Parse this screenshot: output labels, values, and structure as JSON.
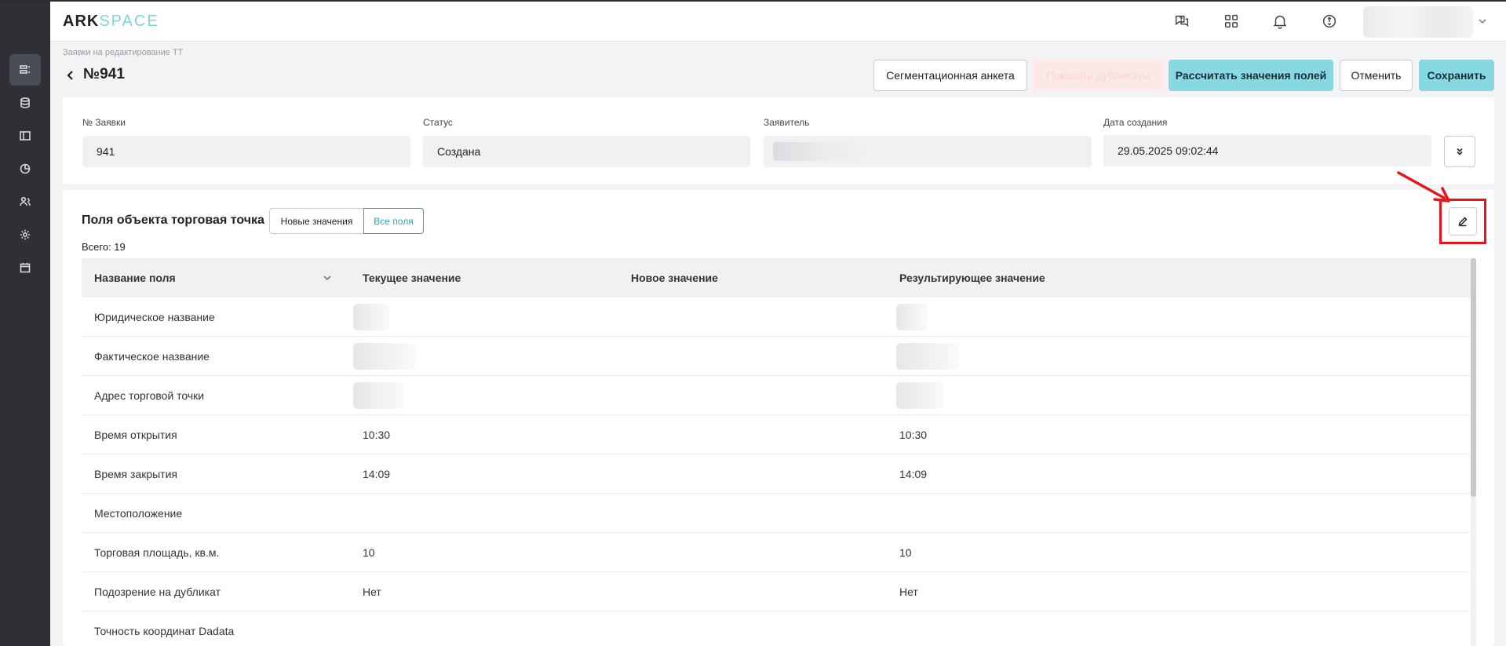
{
  "header": {
    "logo_main": "ARK",
    "logo_accent": "SPACE",
    "icons": [
      "support-chat-icon",
      "apps-grid-icon",
      "bell-icon",
      "sync-icon"
    ]
  },
  "sidebar": {
    "items": [
      "requests-icon",
      "database-icon",
      "layout-icon",
      "analytics-icon",
      "users-icon",
      "settings-icon",
      "calendar-icon"
    ],
    "active_index": 0
  },
  "page": {
    "breadcrumb": "Заявки на редактирование ТТ",
    "title": "№941"
  },
  "toolbar": {
    "segmentation": "Сегментационная анкета",
    "show_duplicates": "Показать дубликаты",
    "calculate": "Рассчитать значения полей",
    "cancel": "Отменить",
    "save": "Сохранить"
  },
  "request_info": {
    "number_label": "№ Заявки",
    "number_value": "941",
    "status_label": "Статус",
    "status_value": "Создана",
    "applicant_label": "Заявитель",
    "created_label": "Дата создания",
    "created_value": "29.05.2025 09:02:44"
  },
  "fields_section": {
    "title": "Поля объекта торговая точка",
    "toggle_new": "Новые значения",
    "toggle_all": "Все поля",
    "total": "Всего: 19",
    "columns": [
      "Название поля",
      "Текущее значение",
      "Новое значение",
      "Результирующее значение"
    ],
    "rows": [
      {
        "name": "Юридическое название",
        "current": "",
        "new": "",
        "result": "",
        "redacted": true
      },
      {
        "name": "Фактическое название",
        "current": "",
        "new": "",
        "result": "",
        "redacted": true
      },
      {
        "name": "Адрес торговой точки",
        "current": "",
        "new": "",
        "result": "",
        "redacted": true
      },
      {
        "name": "Время открытия",
        "current": "10:30",
        "new": "",
        "result": "10:30",
        "redacted": false
      },
      {
        "name": "Время закрытия",
        "current": "14:09",
        "new": "",
        "result": "14:09",
        "redacted": false
      },
      {
        "name": "Местоположение",
        "current": "",
        "new": "",
        "result": "",
        "redacted": false
      },
      {
        "name": "Торговая площадь, кв.м.",
        "current": "10",
        "new": "",
        "result": "10",
        "redacted": false
      },
      {
        "name": "Подозрение на дубликат",
        "current": "Нет",
        "new": "",
        "result": "Нет",
        "redacted": false
      },
      {
        "name": "Точность координат Dadata",
        "current": "",
        "new": "",
        "result": "",
        "redacted": false
      }
    ]
  },
  "annotation_color": "#e8141a"
}
